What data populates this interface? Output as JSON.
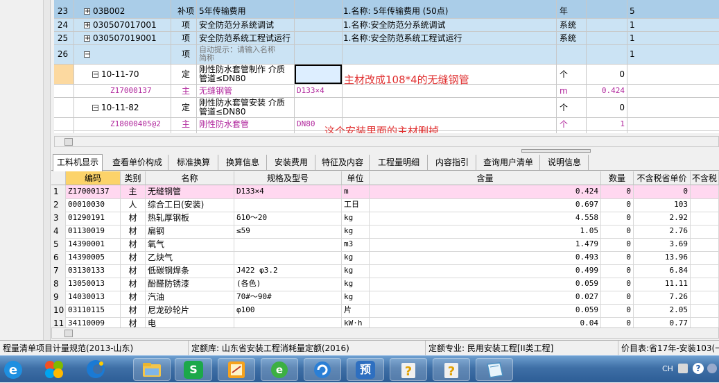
{
  "upper_grid": {
    "rows": [
      {
        "num": "23",
        "code": "03B002",
        "type": "补项",
        "name": "5年传输费用",
        "feature": "1.名称: 5年传输费用 (50点)",
        "unit": "年",
        "qty": "5"
      },
      {
        "num": "24",
        "code": "030507017001",
        "type": "项",
        "name": "安全防范分系统调试",
        "feature": "1.名称:安全防范分系统调试",
        "unit": "系统",
        "qty": "1"
      },
      {
        "num": "25",
        "code": "030507019001",
        "type": "项",
        "name": "安全防范系统工程试运行",
        "feature": "1.名称:安全防范系统工程试运行",
        "unit": "系统",
        "qty": "1"
      },
      {
        "num": "26",
        "code": "",
        "type": "项",
        "name": "自动提示：请输入名称简称",
        "feature": "",
        "unit": "",
        "qty": "1"
      }
    ],
    "quota_rows": [
      {
        "code": "10-11-70",
        "type": "定",
        "name": "刚性防水套管制作 介质管道≤DN80",
        "spec": "",
        "unit": "个",
        "qty": "0"
      },
      {
        "code": "Z17000137",
        "type": "主",
        "name": "无缝钢管",
        "spec": "D133×4",
        "unit": "m",
        "qty": "0.424"
      },
      {
        "code": "10-11-82",
        "type": "定",
        "name": "刚性防水套管安装 介质管道≤DN80",
        "spec": "",
        "unit": "个",
        "qty": "0"
      },
      {
        "code": "Z18000405@2",
        "type": "主",
        "name": "刚性防水套管",
        "spec": "DN80",
        "unit": "个",
        "qty": "1"
      }
    ],
    "annotations": {
      "note1": "主材改成108*4的无缝钢管",
      "note2": "这个安装里面的主材删掉"
    }
  },
  "tabs": [
    "工料机显示",
    "查看单价构成",
    "标准换算",
    "换算信息",
    "安装费用",
    "特征及内容",
    "工程量明细",
    "内容指引",
    "查询用户清单",
    "说明信息"
  ],
  "lower_grid": {
    "headers": [
      "编码",
      "类别",
      "名称",
      "规格及型号",
      "单位",
      "含量",
      "数量",
      "不含税省单价",
      "不含税"
    ],
    "rows": [
      {
        "num": "1",
        "code": "Z17000137",
        "type": "主",
        "name": "无缝钢管",
        "spec": "D133×4",
        "unit": "m",
        "content": "0.424",
        "qty": "0",
        "price": "0"
      },
      {
        "num": "2",
        "code": "00010030",
        "type": "人",
        "name": "综合工日(安装)",
        "spec": "",
        "unit": "工日",
        "content": "0.697",
        "qty": "0",
        "price": "103"
      },
      {
        "num": "3",
        "code": "01290191",
        "type": "材",
        "name": "热轧厚钢板",
        "spec": "δ10～20",
        "unit": "kg",
        "content": "4.558",
        "qty": "0",
        "price": "2.92"
      },
      {
        "num": "4",
        "code": "01130019",
        "type": "材",
        "name": "扁钢",
        "spec": "≤59",
        "unit": "kg",
        "content": "1.05",
        "qty": "0",
        "price": "2.76"
      },
      {
        "num": "5",
        "code": "14390001",
        "type": "材",
        "name": "氧气",
        "spec": "",
        "unit": "m3",
        "content": "1.479",
        "qty": "0",
        "price": "3.69"
      },
      {
        "num": "6",
        "code": "14390005",
        "type": "材",
        "name": "乙炔气",
        "spec": "",
        "unit": "kg",
        "content": "0.493",
        "qty": "0",
        "price": "13.96"
      },
      {
        "num": "7",
        "code": "03130133",
        "type": "材",
        "name": "低碳钢焊条",
        "spec": "J422 φ3.2",
        "unit": "kg",
        "content": "0.499",
        "qty": "0",
        "price": "6.84"
      },
      {
        "num": "8",
        "code": "13050013",
        "type": "材",
        "name": "酚醛防锈漆",
        "spec": "(各色)",
        "unit": "kg",
        "content": "0.059",
        "qty": "0",
        "price": "11.11"
      },
      {
        "num": "9",
        "code": "14030013",
        "type": "材",
        "name": "汽油",
        "spec": "70#～90#",
        "unit": "kg",
        "content": "0.027",
        "qty": "0",
        "price": "7.26"
      },
      {
        "num": "10",
        "code": "03110115",
        "type": "材",
        "name": "尼龙砂轮片",
        "spec": "φ100",
        "unit": "片",
        "content": "0.059",
        "qty": "0",
        "price": "2.05"
      },
      {
        "num": "11",
        "code": "34110009",
        "type": "材",
        "name": "电",
        "spec": "",
        "unit": "kW·h",
        "content": "0.04",
        "qty": "0",
        "price": "0.77"
      }
    ]
  },
  "status_bar": {
    "item1": "程量清单项目计量规范(2013-山东)",
    "item2": "定额库: 山东省安装工程消耗量定额(2016)",
    "item3": "定额专业: 民用安装工程[II类工程]",
    "item4": "价目表:省17年-安装103(一"
  },
  "taskbar": {
    "icons": [
      "ie-icon",
      "media-center-icon",
      "browser-c-icon",
      "explorer-icon",
      "s-app-icon",
      "notes-icon",
      "e-app-icon",
      "swirl-app-icon",
      "yu-app-icon",
      "help-icon-1",
      "help-icon-2",
      "book-icon"
    ],
    "yu_label": "预",
    "s_label": "S",
    "tray_lang": "CH"
  },
  "colors": {
    "selected_row": "#aacde8",
    "highlight_row": "#cbe3f4",
    "main_material_text": "#b0269c",
    "annotation": "#e03030",
    "lower_highlight": "#ffd8f0"
  }
}
